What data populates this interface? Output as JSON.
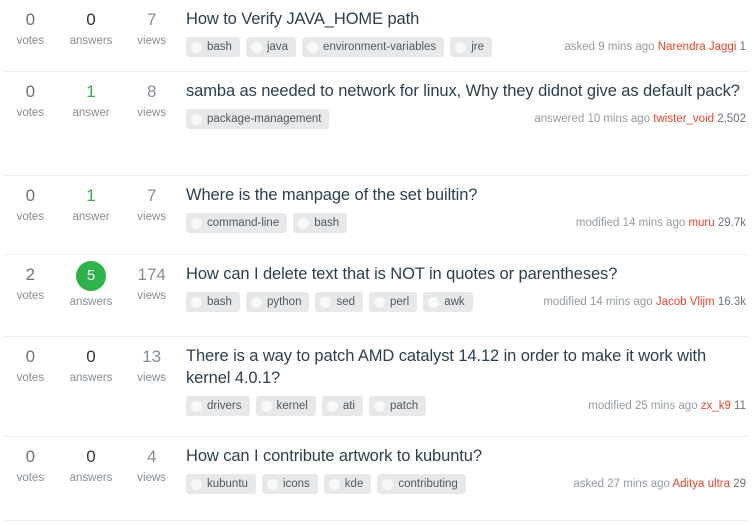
{
  "labels": {
    "votes": "votes",
    "answers_plural": "answers",
    "answers_singular": "answer",
    "views": "views"
  },
  "colors": {
    "accepted_badge": "#2eb34a",
    "answered_green": "#3aa757",
    "title": "#2c3f4c",
    "username": "#e8452c",
    "tag_background": "#e6e8ea",
    "meta_text": "#939ba1",
    "divider": "#eceef0"
  },
  "questions": [
    {
      "votes": "0",
      "votes_label": "votes",
      "answers": "0",
      "answers_label": "answers",
      "answers_state": "none",
      "views": "7",
      "views_label": "views",
      "title": "How to Verify JAVA_HOME path",
      "tags": [
        "bash",
        "java",
        "environment-variables",
        "jre"
      ],
      "action": "asked",
      "time": "9 mins ago",
      "user": "Narendra Jaggi",
      "reputation": "1"
    },
    {
      "votes": "0",
      "votes_label": "votes",
      "answers": "1",
      "answers_label": "answer",
      "answers_state": "answered",
      "views": "8",
      "views_label": "views",
      "title": "samba as needed to network for linux, Why they didnot give as default pack?",
      "tags": [
        "package-management"
      ],
      "action": "answered",
      "time": "10 mins ago",
      "user": "twister_void",
      "reputation": "2,502"
    },
    {
      "votes": "0",
      "votes_label": "votes",
      "answers": "1",
      "answers_label": "answer",
      "answers_state": "answered",
      "views": "7",
      "views_label": "views",
      "title": "Where is the manpage of the set builtin?",
      "tags": [
        "command-line",
        "bash"
      ],
      "action": "modified",
      "time": "14 mins ago",
      "user": "muru",
      "reputation": "29.7k"
    },
    {
      "votes": "2",
      "votes_label": "votes",
      "answers": "5",
      "answers_label": "answers",
      "answers_state": "accepted",
      "views": "174",
      "views_label": "views",
      "title": "How can I delete text that is NOT in quotes or parentheses?",
      "tags": [
        "bash",
        "python",
        "sed",
        "perl",
        "awk"
      ],
      "action": "modified",
      "time": "14 mins ago",
      "user": "Jacob Vlijm",
      "reputation": "16.3k"
    },
    {
      "votes": "0",
      "votes_label": "votes",
      "answers": "0",
      "answers_label": "answers",
      "answers_state": "none",
      "views": "13",
      "views_label": "views",
      "title": "There is a way to patch AMD catalyst 14.12 in order to make it work with kernel 4.0.1?",
      "tags": [
        "drivers",
        "kernel",
        "ati",
        "patch"
      ],
      "action": "modified",
      "time": "25 mins ago",
      "user": "zx_k9",
      "reputation": "11"
    },
    {
      "votes": "0",
      "votes_label": "votes",
      "answers": "0",
      "answers_label": "answers",
      "answers_state": "none",
      "views": "4",
      "views_label": "views",
      "title": "How can I contribute artwork to kubuntu?",
      "tags": [
        "kubuntu",
        "icons",
        "kde",
        "contributing"
      ],
      "action": "asked",
      "time": "27 mins ago",
      "user": "Aditya ultra",
      "reputation": "29"
    }
  ]
}
